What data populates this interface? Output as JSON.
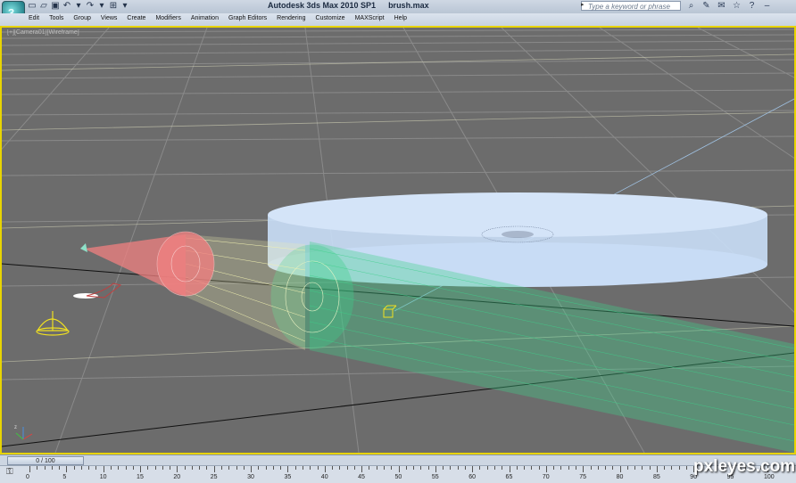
{
  "window": {
    "app_title": "Autodesk 3ds Max  2010 SP1",
    "file_name": "brush.max"
  },
  "app_button": {
    "glyph": "3",
    "icon": "3dsmax-logo-icon"
  },
  "quick_access": [
    {
      "name": "new-file-icon",
      "glyph": "▭"
    },
    {
      "name": "open-file-icon",
      "glyph": "▱"
    },
    {
      "name": "save-icon",
      "glyph": "▣"
    },
    {
      "name": "undo-icon",
      "glyph": "↶"
    },
    {
      "name": "undo-dropdown-icon",
      "glyph": "▾"
    },
    {
      "name": "redo-icon",
      "glyph": "↷"
    },
    {
      "name": "redo-dropdown-icon",
      "glyph": "▾"
    },
    {
      "name": "project-folder-icon",
      "glyph": "⊞"
    },
    {
      "name": "quick-access-dropdown-icon",
      "glyph": "▾"
    }
  ],
  "search": {
    "placeholder": "Type a keyword or phrase",
    "arrow": "▸"
  },
  "toolbar_icons": [
    {
      "name": "binoculars-icon",
      "glyph": "⌕"
    },
    {
      "name": "tools-icon",
      "glyph": "✎"
    },
    {
      "name": "communication-icon",
      "glyph": "✉"
    },
    {
      "name": "favorites-star-icon",
      "glyph": "☆"
    },
    {
      "name": "help-icon",
      "glyph": "?"
    },
    {
      "name": "minimize-icon",
      "glyph": "–"
    }
  ],
  "menu": [
    "Edit",
    "Tools",
    "Group",
    "Views",
    "Create",
    "Modifiers",
    "Animation",
    "Graph Editors",
    "Rendering",
    "Customize",
    "MAXScript",
    "Help"
  ],
  "viewport": {
    "label": "[+][Camera01][Wireframe]",
    "border_color": "#e8d400",
    "grid_color": "#8a8a8a",
    "wire_colors": {
      "pink": "#f08080",
      "yellow": "#f0f0b0",
      "green": "#3ed08a",
      "disc": "#c8dcf5"
    }
  },
  "timeline": {
    "frame_readout": "0 / 100",
    "current": 0,
    "total": 100
  },
  "trackbar": {
    "ticks": [
      "0",
      "5",
      "10",
      "15",
      "20",
      "25",
      "30",
      "35",
      "40",
      "45",
      "50",
      "55",
      "60",
      "65",
      "70",
      "75",
      "80",
      "85",
      "90",
      "95",
      "100"
    ]
  },
  "watermark": "pxleyes.com"
}
